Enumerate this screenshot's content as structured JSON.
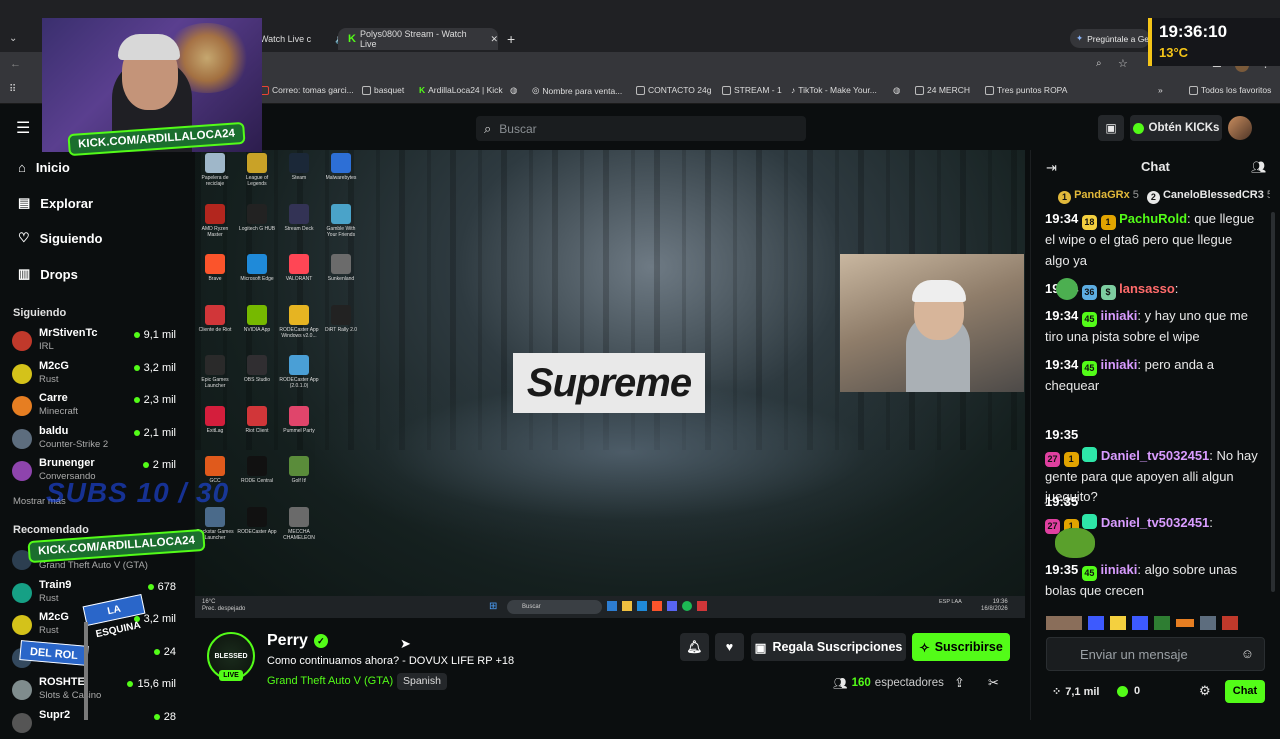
{
  "browser": {
    "tabs": [
      {
        "title": "Watch Live c"
      },
      {
        "title": "Polys0800 Stream - Watch Live"
      }
    ],
    "gemini_label": "Pregúntale a Gemini",
    "bookmarks": [
      "Correo: tomas garci...",
      "basquet",
      "ArdillaLoca24 | Kick",
      "Nombre para venta...",
      "CONTACTO 24g",
      "STREAM - 1",
      "TikTok - Make Your...",
      "24 MERCH",
      "Tres puntos  ROPA",
      "Todos los favoritos"
    ]
  },
  "overlay": {
    "kick_url_top": "KICK.COM/ARDILLALOCA24",
    "kick_url_bottom": "KICK.COM/ARDILLALOCA24",
    "subs_goal": "SUBS 10 / 30",
    "street_sign_1": "LA ESQUINA",
    "street_sign_2": "DEL ROL",
    "clock_time": "19:36:10",
    "clock_temp": "13°C"
  },
  "header": {
    "search_placeholder": "Buscar",
    "get_kicks_label": "Obtén KICKs"
  },
  "sidebar": {
    "nav": [
      {
        "label": "Inicio",
        "icon": "home-icon"
      },
      {
        "label": "Explorar",
        "icon": "compass-icon"
      },
      {
        "label": "Siguiendo",
        "icon": "heart-icon"
      },
      {
        "label": "Drops",
        "icon": "drops-icon"
      }
    ],
    "following_title": "Siguiendo",
    "following": [
      {
        "name": "MrStivenTc",
        "category": "IRL",
        "viewers": "9,1 mil",
        "color": "#c0392b"
      },
      {
        "name": "M2cG",
        "category": "Rust",
        "viewers": "3,2 mil",
        "color": "#d4c21a"
      },
      {
        "name": "Carre",
        "category": "Minecraft",
        "viewers": "2,3 mil",
        "color": "#e67e22"
      },
      {
        "name": "baldu",
        "category": "Counter-Strike 2",
        "viewers": "2,1 mil",
        "color": "#5d6d7e"
      },
      {
        "name": "Brunenger",
        "category": "Conversando",
        "viewers": "2 mil",
        "color": "#8e44ad"
      }
    ],
    "show_more": "Mostrar más",
    "recommended_title": "Recomendado",
    "recommended": [
      {
        "name": "",
        "category": "Grand Theft Auto V (GTA)",
        "viewers": "",
        "color": "#2c3e50"
      },
      {
        "name": "Train9",
        "category": "Rust",
        "viewers": "678",
        "color": "#16a085"
      },
      {
        "name": "M2cG",
        "category": "Rust",
        "viewers": "3,2 mil",
        "color": "#d4c21a"
      },
      {
        "name": "",
        "category": "",
        "viewers": "24",
        "color": "#34495e"
      },
      {
        "name": "ROSHTE",
        "category": "Slots & Casino",
        "viewers": "15,6 mil",
        "color": "#7f8c8d"
      },
      {
        "name": "Supr2",
        "category": "",
        "viewers": "28",
        "color": "#555555"
      }
    ]
  },
  "video": {
    "desktop_icons": [
      {
        "label": "Papelera de reciclaje",
        "color": "#9fb7c9"
      },
      {
        "label": "League of Legends",
        "color": "#c9a227"
      },
      {
        "label": "Steam",
        "color": "#1b2838"
      },
      {
        "label": "Malwarebytes",
        "color": "#2d6fd6"
      },
      {
        "label": "AMD Ryzen Master",
        "color": "#b3261e"
      },
      {
        "label": "Logitech G HUB",
        "color": "#222222"
      },
      {
        "label": "Stream Deck",
        "color": "#333355"
      },
      {
        "label": "Gamble With Your Friends",
        "color": "#4aa3c9"
      },
      {
        "label": "Brave",
        "color": "#fb542b"
      },
      {
        "label": "Microsoft Edge",
        "color": "#1f8ad9"
      },
      {
        "label": "VALORANT",
        "color": "#ff4655"
      },
      {
        "label": "Sunkenland",
        "color": "#6b6b6b"
      },
      {
        "label": "Cliente de Riot",
        "color": "#d13639"
      },
      {
        "label": "NVIDIA App",
        "color": "#76b900"
      },
      {
        "label": "RODECaster App Windows v2.0...",
        "color": "#e6b422"
      },
      {
        "label": "DiRT Rally 2.0",
        "color": "#222222"
      },
      {
        "label": "Epic Games Launcher",
        "color": "#2a2a2a"
      },
      {
        "label": "OBS Studio",
        "color": "#302e31"
      },
      {
        "label": "RODECaster App (2.0.1.0)",
        "color": "#4a9fd6"
      },
      {
        "label": "",
        "color": "#9b9b9b"
      },
      {
        "label": "ExitLag",
        "color": "#d41e3c"
      },
      {
        "label": "Riot Client",
        "color": "#d13639"
      },
      {
        "label": "Pummel Party",
        "color": "#e0456b"
      },
      {
        "label": "",
        "color": "#444444"
      },
      {
        "label": "GCC",
        "color": "#e05a1c"
      },
      {
        "label": "RODE Central",
        "color": "#111111"
      },
      {
        "label": "Golf It!",
        "color": "#5a8c3a"
      },
      {
        "label": "",
        "color": "#444444"
      },
      {
        "label": "Rockstar Games Launcher",
        "color": "#4a6a8a"
      },
      {
        "label": "RODECaster App",
        "color": "#111111"
      },
      {
        "label": "MECCHA CHAMELEON",
        "color": "#6a6a6a"
      }
    ],
    "supreme_text": "Supreme",
    "taskbar": {
      "weather_temp": "16°C",
      "weather_desc": "Prec. despejado",
      "search": "Buscar",
      "lang": "ESP LAA",
      "time": "19:36",
      "date": "16/8/2026"
    }
  },
  "stream": {
    "streamer_name": "Perry",
    "title": "Como continuamos ahora? - DOVUX LIFE RP +18",
    "category": "Grand Theft Auto V (GTA)",
    "language_tag": "Spanish",
    "live_label": "LIVE",
    "avatar_text": "BLESSED",
    "gift_subs_label": "Regala Suscripciones",
    "subscribe_label": "Suscribirse",
    "viewers_count": "160",
    "viewers_label": "espectadores"
  },
  "chat": {
    "title": "Chat",
    "top_gifters": [
      {
        "name": "PandaGRx",
        "count": "5",
        "rank": "1",
        "color": "#e2b93b"
      },
      {
        "name": "CaneloBlessedCR3",
        "count": "5",
        "rank": "2",
        "color": "#e8e8e8"
      }
    ],
    "messages": [
      {
        "time": "19:34",
        "badges": [
          {
            "text": "18",
            "color": "#f4d03f"
          },
          {
            "text": "1",
            "color": "#e2a400"
          }
        ],
        "user": "PachuRold",
        "user_color": "#53fc18",
        "text": "que llegue el wipe o el gta6 pero que llegue algo ya"
      },
      {
        "time": "19:34",
        "badges": [
          {
            "text": "36",
            "color": "#5dade2"
          },
          {
            "text": "$",
            "color": "#7dcea0"
          }
        ],
        "user": "lansasso",
        "user_color": "#ff6b6b",
        "text": ""
      },
      {
        "time": "19:34",
        "badges": [
          {
            "text": "45",
            "color": "#53fc18"
          }
        ],
        "user": "iiniaki",
        "user_color": "#d99cff",
        "text": "y hay uno que me tiro una pista sobre el wipe"
      },
      {
        "time": "19:34",
        "badges": [
          {
            "text": "45",
            "color": "#53fc18"
          }
        ],
        "user": "iiniaki",
        "user_color": "#d99cff",
        "text": "pero anda a chequear"
      },
      {
        "time": "19:35",
        "badges": [
          {
            "text": "27",
            "color": "#e040a0"
          },
          {
            "text": "1",
            "color": "#e2a400"
          },
          {
            "text": "",
            "color": "#2ee6a8"
          }
        ],
        "user": "Daniel_tv5032451",
        "user_color": "#d99cff",
        "text": "No hay gente para que apoyen alli algun jueguito?"
      },
      {
        "time": "19:35",
        "badges": [
          {
            "text": "27",
            "color": "#e040a0"
          },
          {
            "text": "1",
            "color": "#e2a400"
          },
          {
            "text": "",
            "color": "#2ee6a8"
          }
        ],
        "user": "Daniel_tv5032451",
        "user_color": "#d99cff",
        "text": ""
      },
      {
        "time": "19:35",
        "badges": [
          {
            "text": "45",
            "color": "#53fc18"
          }
        ],
        "user": "iiniaki",
        "user_color": "#d99cff",
        "text": "algo sobre unas bolas que crecen"
      }
    ],
    "input_placeholder": "Enviar un mensaje",
    "followers_count": "7,1 mil",
    "kicks_count": "0",
    "send_label": "Chat"
  },
  "colors": {
    "accent": "#53fc18",
    "background": "#0b0e0f",
    "surface": "#1a1d1f"
  }
}
